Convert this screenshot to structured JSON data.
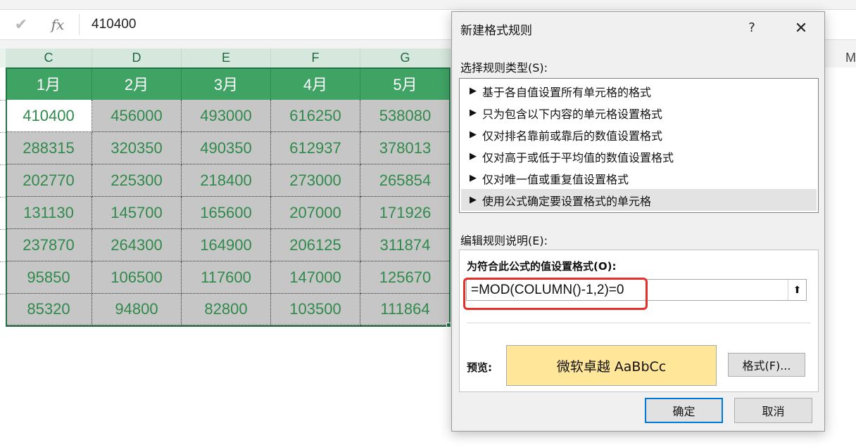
{
  "formula_bar": {
    "check_icon": "check-icon",
    "fx_label": "fx",
    "value": "410400"
  },
  "columns": [
    "C",
    "D",
    "E",
    "F",
    "G"
  ],
  "column_far_right": "M",
  "months": [
    "1月",
    "2月",
    "3月",
    "4月",
    "5月"
  ],
  "rows": [
    [
      "410400",
      "456000",
      "493000",
      "616250",
      "538080"
    ],
    [
      "288315",
      "320350",
      "490350",
      "612937",
      "378013"
    ],
    [
      "202770",
      "225300",
      "218400",
      "273000",
      "265854"
    ],
    [
      "131130",
      "145700",
      "165600",
      "207000",
      "171926"
    ],
    [
      "237870",
      "264300",
      "164900",
      "206125",
      "311874"
    ],
    [
      "95850",
      "106500",
      "117600",
      "147000",
      "125670"
    ],
    [
      "85320",
      "94800",
      "82800",
      "103500",
      "111864"
    ]
  ],
  "dialog": {
    "title": "新建格式规则",
    "help": "?",
    "close": "✕",
    "rule_type_label": "选择规则类型(S):",
    "rule_types": [
      "基于各自值设置所有单元格的格式",
      "只为包含以下内容的单元格设置格式",
      "仅对排名靠前或靠后的数值设置格式",
      "仅对高于或低于平均值的数值设置格式",
      "仅对唯一值或重复值设置格式",
      "使用公式确定要设置格式的单元格"
    ],
    "selected_rule_index": 5,
    "edit_desc_label": "编辑规则说明(E):",
    "formula_heading": "为符合此公式的值设置格式(O):",
    "formula_value": "=MOD(COLUMN()-1,2)=0",
    "preview_label": "预览:",
    "preview_text": "微软卓越  AaBbCc",
    "format_button": "格式(F)...",
    "ok_button": "确定",
    "cancel_button": "取消"
  },
  "colors": {
    "header_green": "#3fa364",
    "excel_green": "#217346",
    "data_text_green": "#2f8a4b",
    "cell_gray": "#c6c6c6",
    "preview_fill": "#ffe699",
    "highlight_red": "#e5302a",
    "ok_border": "#0078d7"
  }
}
